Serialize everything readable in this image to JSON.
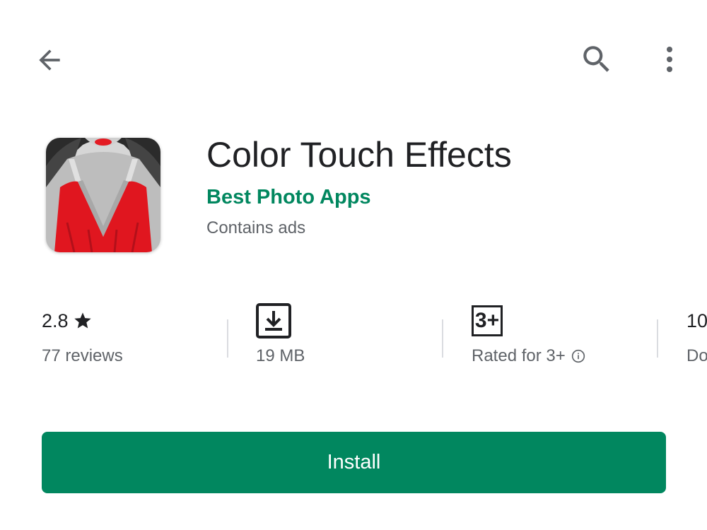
{
  "colors": {
    "accent": "#01875f",
    "text_primary": "#202124",
    "text_secondary": "#5f6368"
  },
  "toolbar": {
    "back_icon": "arrow-left-icon",
    "search_icon": "search-icon",
    "more_icon": "more-vert-icon"
  },
  "app": {
    "title": "Color Touch Effects",
    "developer": "Best Photo Apps",
    "contains_ads": "Contains ads",
    "icon": "app-icon-woman-red-dress"
  },
  "stats": {
    "rating": {
      "value": "2.8",
      "icon": "star-icon",
      "label": "77 reviews"
    },
    "size": {
      "icon": "download-icon",
      "label": "19 MB"
    },
    "content_rating": {
      "badge": "3+",
      "label": "Rated for 3+",
      "info_icon": "info-icon"
    },
    "downloads": {
      "value": "10",
      "label": "Do"
    }
  },
  "install": {
    "label": "Install"
  }
}
